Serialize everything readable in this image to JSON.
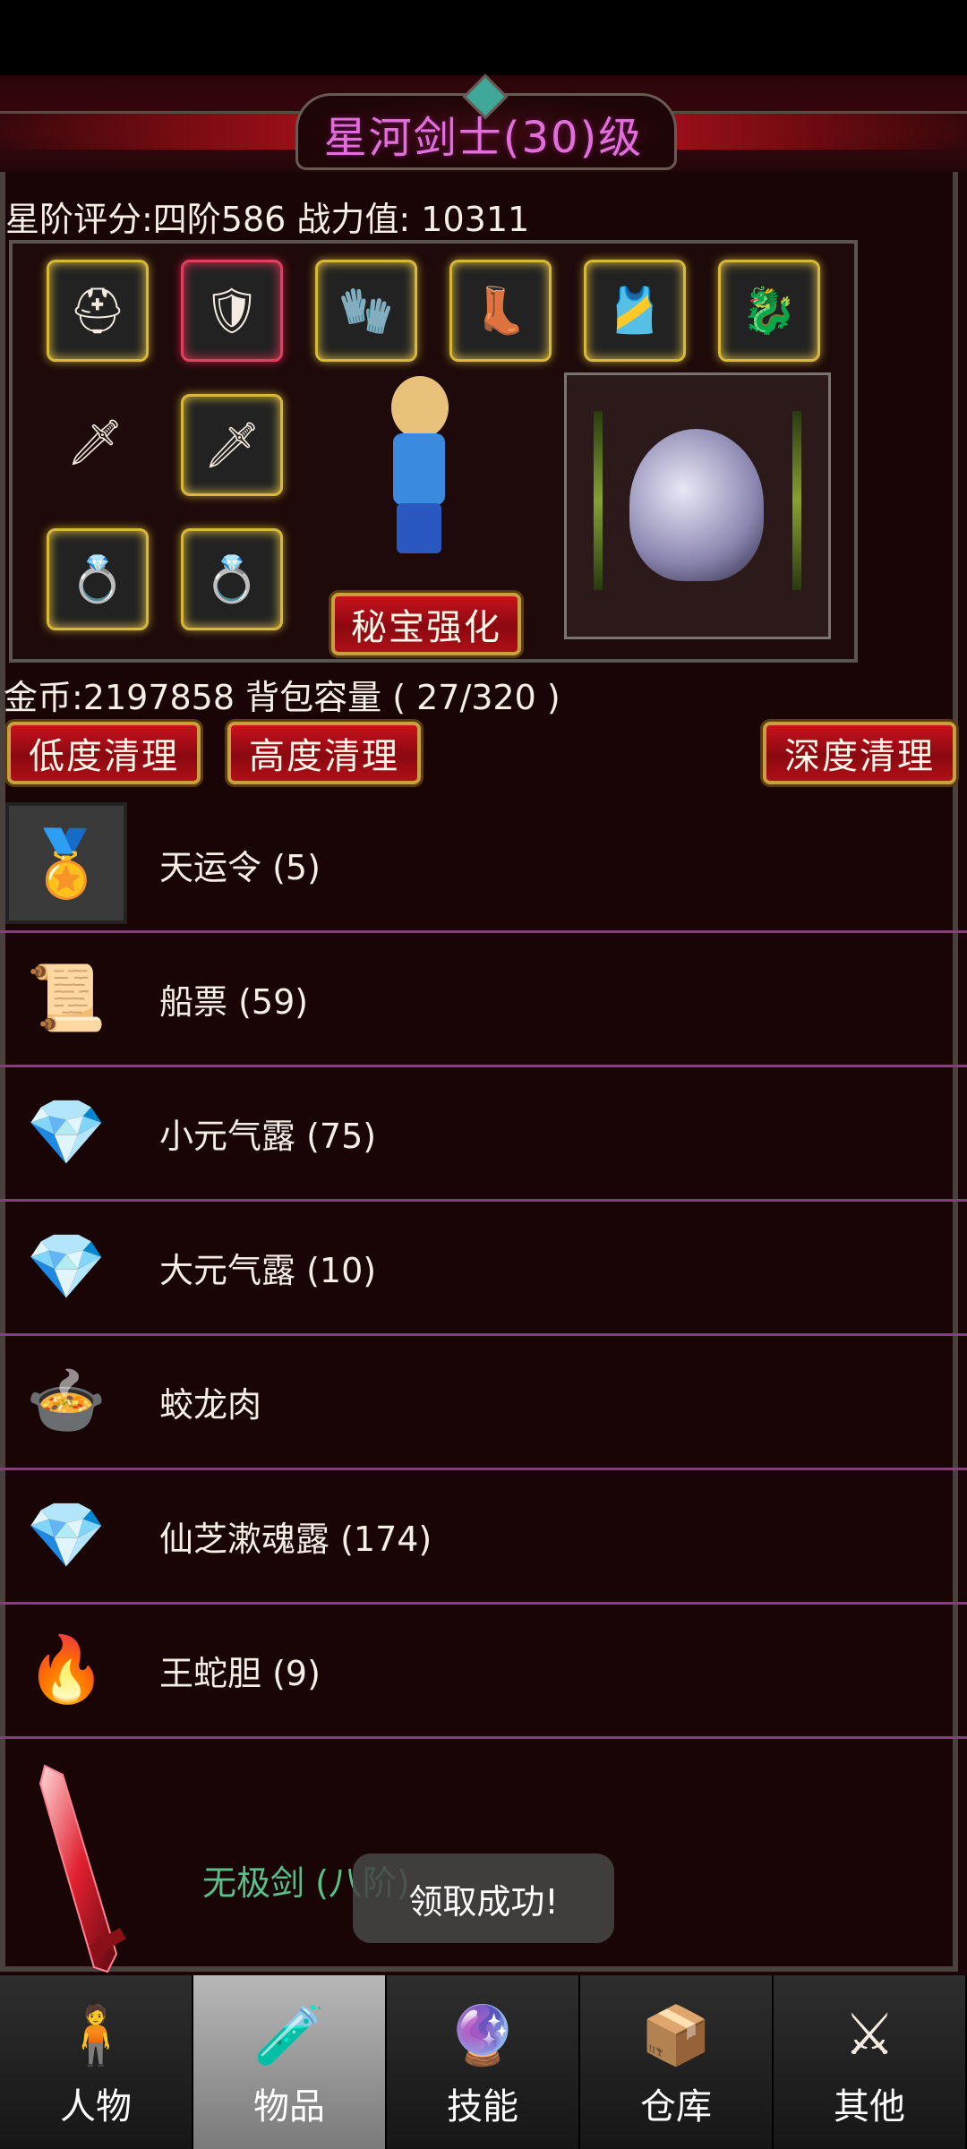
{
  "header": {
    "title": "星河剑士(30)级"
  },
  "stats": {
    "star_rating": "星阶评分:四阶586  战力值: 10311"
  },
  "equipment": {
    "slots": [
      {
        "icon": "helmet-icon",
        "glyph": "⛑"
      },
      {
        "icon": "armor-icon",
        "glyph": "🛡"
      },
      {
        "icon": "gauntlet-icon",
        "glyph": "🧤"
      },
      {
        "icon": "boots-icon",
        "glyph": "👢"
      },
      {
        "icon": "belt-icon",
        "glyph": "🎽"
      },
      {
        "icon": "dragon-pendant-icon",
        "glyph": "🐉"
      },
      {
        "icon": "blue-sword-icon",
        "glyph": "🗡"
      },
      {
        "icon": "blue-sword-icon",
        "glyph": "🗡"
      },
      {
        "icon": "purple-ring-icon",
        "glyph": "💍"
      },
      {
        "icon": "gold-ring-icon",
        "glyph": "💍"
      }
    ],
    "enhance_button": "秘宝强化"
  },
  "bag": {
    "gold_line": "金币:2197858  背包容量 ( 27/320 )"
  },
  "cleanup": {
    "low": "低度清理",
    "high": "高度清理",
    "deep": "深度清理"
  },
  "items": [
    {
      "name": "天运令 (5)",
      "icon": "token-icon",
      "glyph": "🏅"
    },
    {
      "name": "船票 (59)",
      "icon": "scroll-icon",
      "glyph": "📜"
    },
    {
      "name": "小元气露 (75)",
      "icon": "crystal-potion-icon",
      "glyph": "💎"
    },
    {
      "name": "大元气露 (10)",
      "icon": "crystal-potion-icon",
      "glyph": "💎"
    },
    {
      "name": "蛟龙肉",
      "icon": "meat-dish-icon",
      "glyph": "🍲"
    },
    {
      "name": "仙芝漱魂露 (174)",
      "icon": "crystal-potion-icon",
      "glyph": "💎"
    },
    {
      "name": "王蛇胆 (9)",
      "icon": "fire-gall-icon",
      "glyph": "🔥"
    }
  ],
  "last_item": {
    "name": "无极剑 (八阶)"
  },
  "toast": {
    "text": "领取成功!"
  },
  "tabs": [
    {
      "label": "人物",
      "icon": "character-icon",
      "glyph": "🧍"
    },
    {
      "label": "物品",
      "icon": "potion-bag-icon",
      "glyph": "🧪"
    },
    {
      "label": "技能",
      "icon": "skill-orb-icon",
      "glyph": "🔮"
    },
    {
      "label": "仓库",
      "icon": "warehouse-icon",
      "glyph": "📦"
    },
    {
      "label": "其他",
      "icon": "other-icon",
      "glyph": "⚔"
    }
  ],
  "active_tab": 1
}
